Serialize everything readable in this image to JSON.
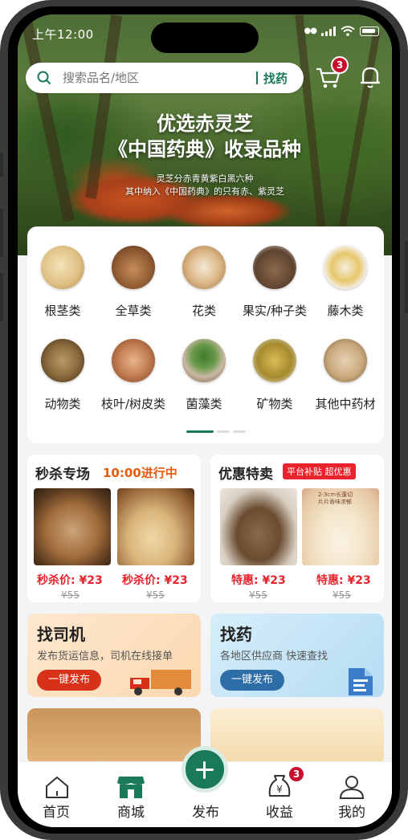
{
  "status_bar": {
    "time": "上午12:00"
  },
  "search": {
    "placeholder": "搜索品名/地区",
    "button": "找药"
  },
  "cart": {
    "badge": "3"
  },
  "banner": {
    "title_line1": "优选赤灵芝",
    "title_line2": "《中国药典》收录品种",
    "sub_line1": "灵芝分赤青黄紫白黑六种",
    "sub_line2": "其中纳入《中国药典》的只有赤、紫灵芝"
  },
  "categories": [
    {
      "label": "根茎类",
      "icon": "root-slices-image"
    },
    {
      "label": "全草类",
      "icon": "whole-herb-image"
    },
    {
      "label": "花类",
      "icon": "flower-image"
    },
    {
      "label": "果实/种子类",
      "icon": "fruit-seed-image"
    },
    {
      "label": "藤木类",
      "icon": "vine-wood-image"
    },
    {
      "label": "动物类",
      "icon": "animal-image"
    },
    {
      "label": "枝叶/树皮类",
      "icon": "bark-image"
    },
    {
      "label": "菌藻类",
      "icon": "fungus-image"
    },
    {
      "label": "矿物类",
      "icon": "mineral-image"
    },
    {
      "label": "其他中药材",
      "icon": "other-herb-image"
    }
  ],
  "flash_sale": {
    "title": "秒杀专场",
    "status": "10:00进行中",
    "items": [
      {
        "price": "秒杀价: ¥23",
        "old": "¥55"
      },
      {
        "price": "秒杀价: ¥23",
        "old": "¥55"
      }
    ]
  },
  "discount": {
    "title": "优惠特卖",
    "tag": "平台补贴 超优惠",
    "items": [
      {
        "price": "特惠: ¥23",
        "old": "¥55"
      },
      {
        "price": "特惠: ¥23",
        "old": "¥55"
      }
    ],
    "img_caption_1": "2-3cm长蓬切",
    "img_caption_2": "片片香味浓郁"
  },
  "driver": {
    "title": "找司机",
    "desc": "发布货运信息，司机在线接单",
    "button": "一键发布"
  },
  "medicine": {
    "title": "找药",
    "desc": "各地区供应商 快速查找",
    "button": "一键发布"
  },
  "tabs": [
    {
      "label": "首页",
      "icon": "home-icon"
    },
    {
      "label": "商城",
      "icon": "store-icon"
    },
    {
      "label": "发布",
      "icon": "plus-icon"
    },
    {
      "label": "收益",
      "icon": "earnings-icon",
      "badge": "3"
    },
    {
      "label": "我的",
      "icon": "profile-icon"
    }
  ],
  "colors": {
    "brand_green": "#1a7a57",
    "sale_orange": "#e85a0c",
    "price_red": "#e8232b",
    "badge_red": "#c8102e"
  }
}
